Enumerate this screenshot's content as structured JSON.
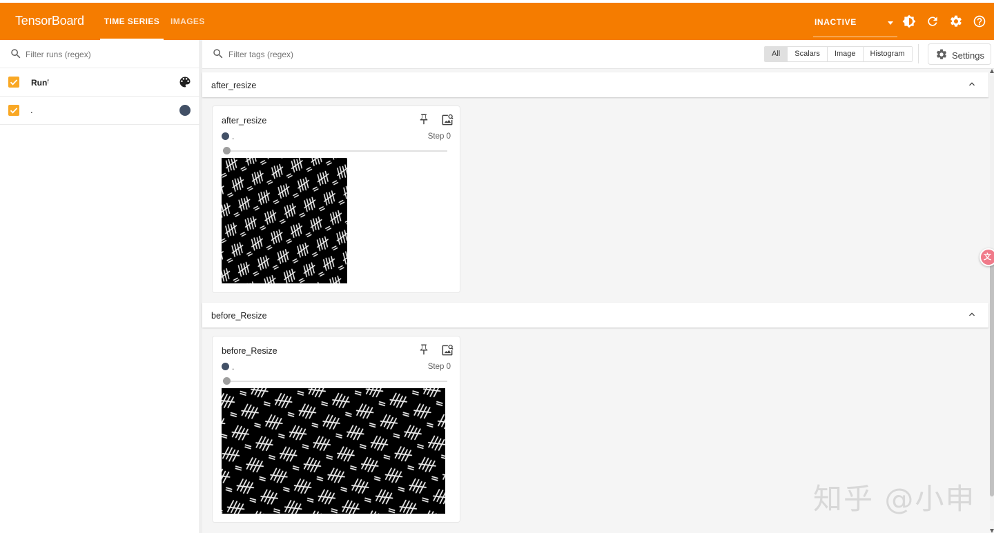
{
  "app": {
    "brand": "TensorBoard"
  },
  "header": {
    "tabs": [
      {
        "label": "TIME SERIES",
        "active": true
      },
      {
        "label": "IMAGES",
        "active": false
      }
    ],
    "reload_status": "INACTIVE",
    "icons": [
      "theme-toggle-icon",
      "refresh-icon",
      "settings-gear-icon",
      "help-icon"
    ],
    "color": "#f57c00"
  },
  "sidebar": {
    "filter_placeholder": "Filter runs (regex)",
    "run_header": {
      "label": "Run",
      "sort_arrow": "↑"
    },
    "runs": [
      {
        "name": ".",
        "checked": true,
        "color": "#425066"
      }
    ],
    "checkbox_color": "#f9a825"
  },
  "main": {
    "filter_placeholder": "Filter tags (regex)",
    "type_filters": [
      {
        "label": "All",
        "active": true
      },
      {
        "label": "Scalars",
        "active": false
      },
      {
        "label": "Image",
        "active": false
      },
      {
        "label": "Histogram",
        "active": false
      }
    ],
    "settings_label": "Settings",
    "groups": [
      {
        "name": "after_resize",
        "card": {
          "title": "after_resize",
          "run": ".",
          "step": "Step 0"
        }
      },
      {
        "name": "before_Resize",
        "card": {
          "title": "before_Resize",
          "run": ".",
          "step": "Step 0"
        }
      }
    ]
  },
  "watermark": "知乎 @小申"
}
